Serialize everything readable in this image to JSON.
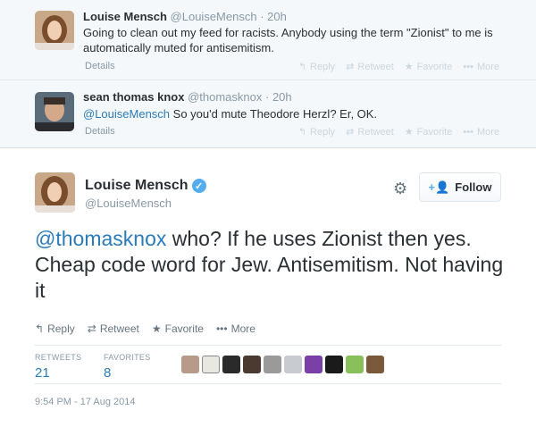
{
  "context_tweets": [
    {
      "fullname": "Louise Mensch",
      "username": "@LouiseMensch",
      "time": "20h",
      "text": "Going to clean out my feed for racists. Anybody using the term \"Zionist\" to me is automatically muted for antisemitism.",
      "details": "Details"
    },
    {
      "fullname": "sean thomas knox",
      "username": "@thomasknox",
      "time": "20h",
      "mention": "@LouiseMensch",
      "text": " So you'd mute Theodore Herzl? Er, OK.",
      "details": "Details"
    }
  ],
  "context_actions": {
    "reply": "Reply",
    "retweet": "Retweet",
    "favorite": "Favorite",
    "more": "More"
  },
  "main_tweet": {
    "fullname": "Louise Mensch",
    "username": "@LouiseMensch",
    "follow_label": "Follow",
    "mention": "@thomasknox",
    "text": " who? If he uses Zionist then yes. Cheap code word for Jew. Antisemitism. Not having it",
    "actions": {
      "reply": "Reply",
      "retweet": "Retweet",
      "favorite": "Favorite",
      "more": "More"
    },
    "stats": {
      "retweets_label": "RETWEETS",
      "retweets": "21",
      "favorites_label": "FAVORITES",
      "favorites": "8"
    },
    "timestamp": "9:54 PM - 17 Aug 2014"
  },
  "colors": {
    "link": "#2b7bb9",
    "verified": "#55acee",
    "context_bg": "#f5f8fa"
  },
  "icons": [
    "reply-icon",
    "retweet-icon",
    "favorite-star-icon",
    "more-dots-icon",
    "gear-icon",
    "follow-person-icon",
    "verified-badge-icon"
  ]
}
